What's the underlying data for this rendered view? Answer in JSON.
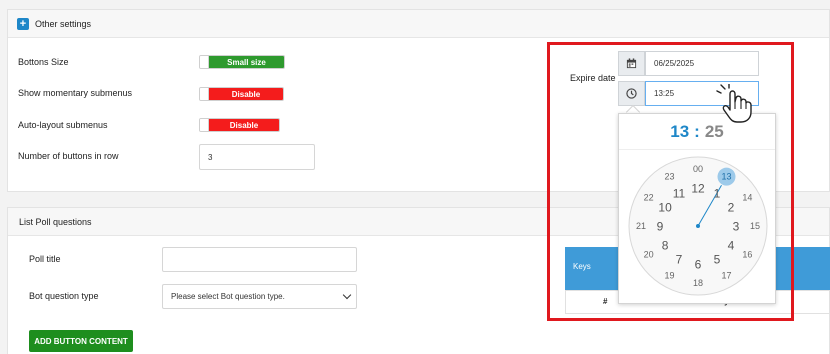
{
  "other_settings": {
    "title": "Other settings",
    "buttons_size": {
      "label": "Bottons Size",
      "value": "Small size",
      "color": "#2e9a2e"
    },
    "momentary_submenus": {
      "label": "Show momentary submenus",
      "value": "Disable",
      "color": "#f41c1c"
    },
    "auto_layout": {
      "label": "Auto-layout submenus",
      "value": "Disable",
      "color": "#f41c1c"
    },
    "num_buttons": {
      "label": "Number of buttons in row",
      "value": "3"
    },
    "expire_date": {
      "label": "Expire date",
      "date": "06/25/2025",
      "time": "13:25"
    }
  },
  "time_picker": {
    "hour": "13",
    "separator": ":",
    "minute": "25",
    "outer_hours": [
      "13",
      "14",
      "15",
      "16",
      "17",
      "18",
      "19",
      "20",
      "21",
      "22",
      "23",
      "00"
    ],
    "inner_hours": [
      "1",
      "2",
      "3",
      "4",
      "5",
      "6",
      "7",
      "8",
      "9",
      "10",
      "11",
      "12"
    ],
    "selected_hour": "13",
    "accent": "#1e87c8"
  },
  "poll": {
    "title": "List Poll questions",
    "poll_title_label": "Poll title",
    "poll_title_value": "",
    "bot_qtype_label": "Bot question type",
    "bot_qtype_selected": "Please select Bot question type.",
    "add_button": "ADD BUTTON CONTENT",
    "keys_table": {
      "header": "Keys",
      "col_hash": "#",
      "col_keys": "Keys"
    }
  },
  "icons": [
    "plus-icon",
    "calendar-icon",
    "clock-icon",
    "hand-cursor-icon",
    "chevron-down-icon"
  ]
}
